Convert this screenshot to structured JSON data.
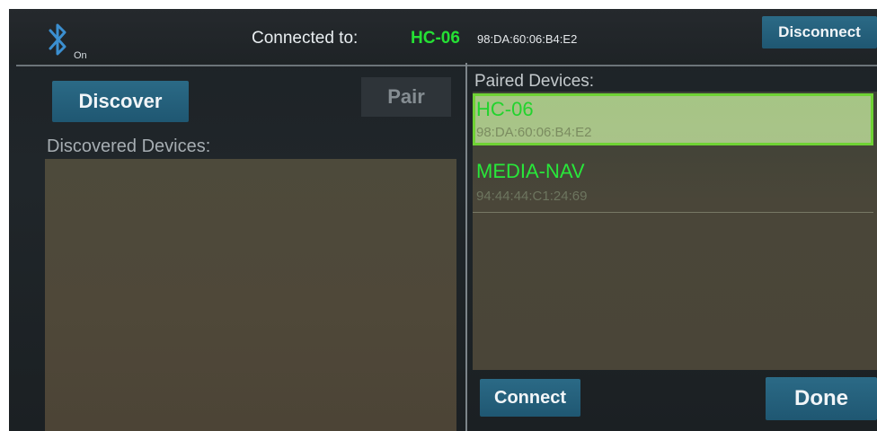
{
  "header": {
    "bluetooth_status": "On",
    "connected_label": "Connected to:",
    "connected_device": "HC-06",
    "connected_address": "98:DA:60:06:B4:E2",
    "disconnect_label": "Disconnect"
  },
  "discover_panel": {
    "discover_label": "Discover",
    "pair_label": "Pair",
    "discovered_heading": "Discovered Devices:",
    "devices": []
  },
  "paired_panel": {
    "heading": "Paired Devices:",
    "devices": [
      {
        "name": "HC-06",
        "address": "98:DA:60:06:B4:E2",
        "selected": true
      },
      {
        "name": "MEDIA-NAV",
        "address": "94:44:44:C1:24:69",
        "selected": false
      }
    ],
    "connect_label": "Connect",
    "done_label": "Done"
  },
  "colors": {
    "accent_button": "#256580",
    "connected_text": "#25e034",
    "selected_row": "#a6c585",
    "selected_border": "#6fd234"
  },
  "icons": {
    "bluetooth": "bluetooth-icon"
  }
}
